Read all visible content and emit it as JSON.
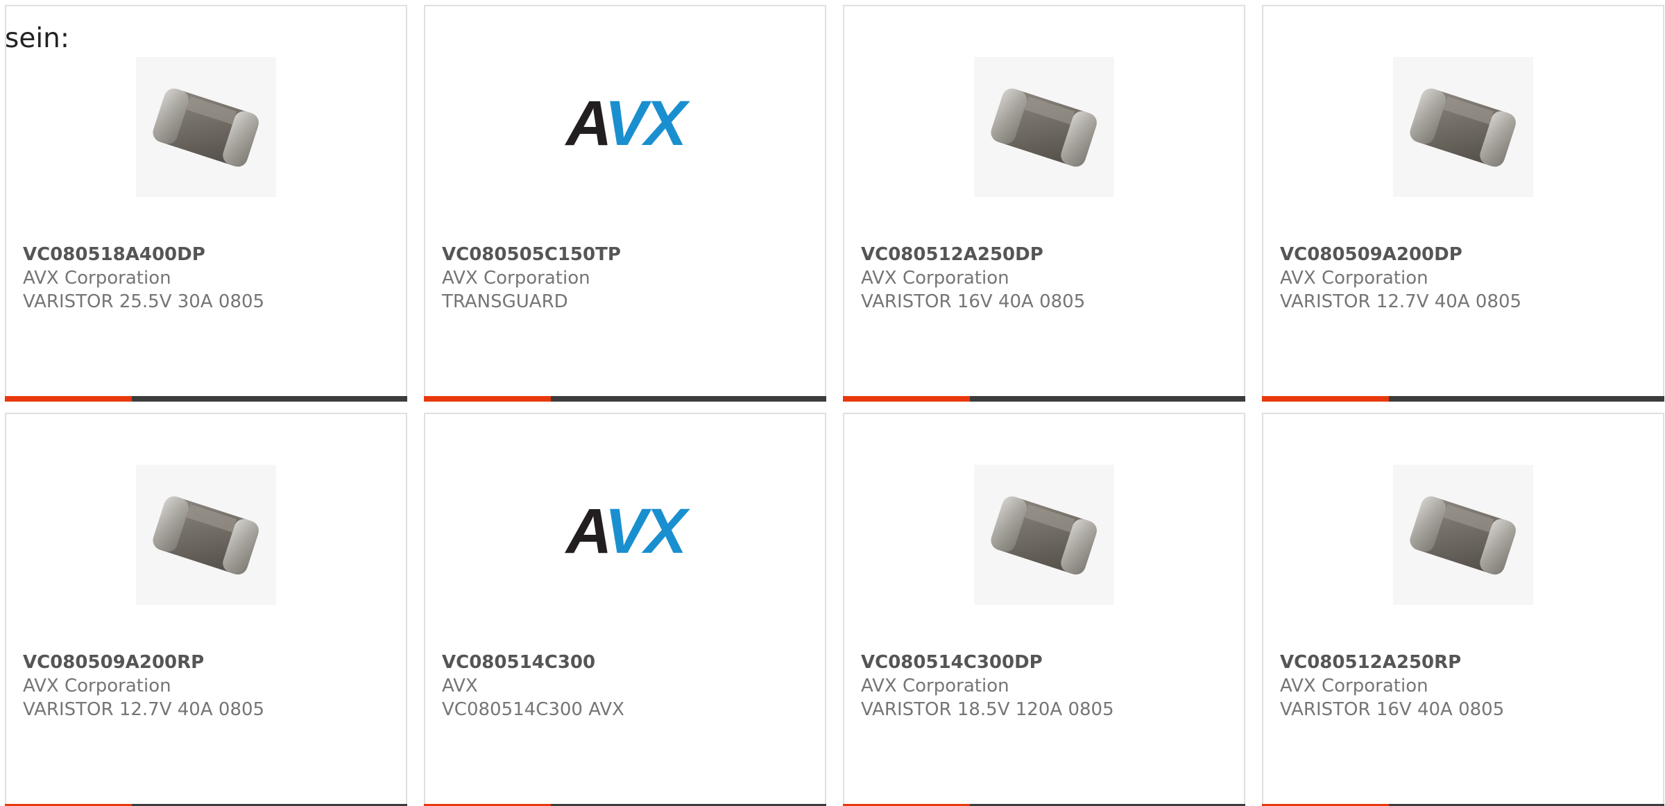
{
  "intro_text": "sein:",
  "colors": {
    "accent": "#e8380d",
    "bar_dark": "#3c3c3c",
    "border": "#e0e0e0",
    "avx_dark": "#231f20",
    "avx_blue": "#1a8fd0"
  },
  "products": [
    {
      "part": "VC080518A400DP",
      "maker": "AVX Corporation",
      "desc": "VARISTOR 25.5V 30A 0805",
      "image": "chip-varistor-photo"
    },
    {
      "part": "VC080505C150TP",
      "maker": "AVX Corporation",
      "desc": "TRANSGUARD",
      "image": "avx-logo",
      "logo_text": "AVX"
    },
    {
      "part": "VC080512A250DP",
      "maker": "AVX Corporation",
      "desc": "VARISTOR 16V 40A 0805",
      "image": "chip-varistor-photo"
    },
    {
      "part": "VC080509A200DP",
      "maker": "AVX Corporation",
      "desc": "VARISTOR 12.7V 40A 0805",
      "image": "chip-varistor-photo"
    },
    {
      "part": "VC080509A200RP",
      "maker": "AVX Corporation",
      "desc": "VARISTOR 12.7V 40A 0805",
      "image": "chip-varistor-photo"
    },
    {
      "part": "VC080514C300",
      "maker": "AVX",
      "desc": "VC080514C300 AVX",
      "image": "avx-logo",
      "logo_text": "AVX"
    },
    {
      "part": "VC080514C300DP",
      "maker": "AVX Corporation",
      "desc": "VARISTOR 18.5V 120A 0805",
      "image": "chip-varistor-photo"
    },
    {
      "part": "VC080512A250RP",
      "maker": "AVX Corporation",
      "desc": "VARISTOR 16V 40A 0805",
      "image": "chip-varistor-photo"
    }
  ]
}
